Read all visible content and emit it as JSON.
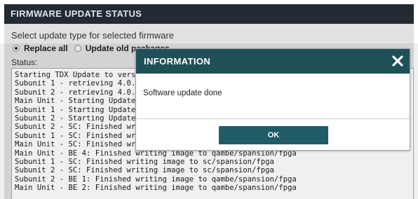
{
  "panel": {
    "title": "FIRMWARE UPDATE STATUS",
    "prompt": "Select update type for selected firmware",
    "options": [
      {
        "label": "Replace all",
        "selected": true
      },
      {
        "label": "Update old packages",
        "selected": false
      }
    ],
    "status_label": "Status:",
    "log": [
      "Starting TDX Update to versi",
      "Subunit 1 - retrieving 4.0.1",
      "Subunit 2 - retrieving 4.0.1",
      "Main Unit - Starting Update",
      "Subunit 1 - Starting Update",
      "Subunit 2 - Starting Update",
      "Subunit 2 - SC: Finished writi",
      "Subunit 1 - SC: Finished writi",
      "Main Unit - SC: Finished wri",
      "Main Unit - BE 4: Finished writing image to qambe/spansion/fpga",
      "Subunit 1 - SC: Finished writing image to sc/spansion/fpga",
      "Subunit 2 - SC: Finished writing image to sc/spansion/fpga",
      "Subunit 2 - BE 1: Finished writing image to qambe/spansion/fpga",
      "Main Unit - BE 2: Finished writing image to qambe/spansion/fpga"
    ]
  },
  "dialog": {
    "title": "INFORMATION",
    "message": "Software update done",
    "ok_label": "OK",
    "close_icon": "close-x"
  },
  "colors": {
    "panel_header_bg": "#222a34",
    "dialog_header_bg": "#1f4f57",
    "ok_button_bg": "#1f5c66"
  }
}
